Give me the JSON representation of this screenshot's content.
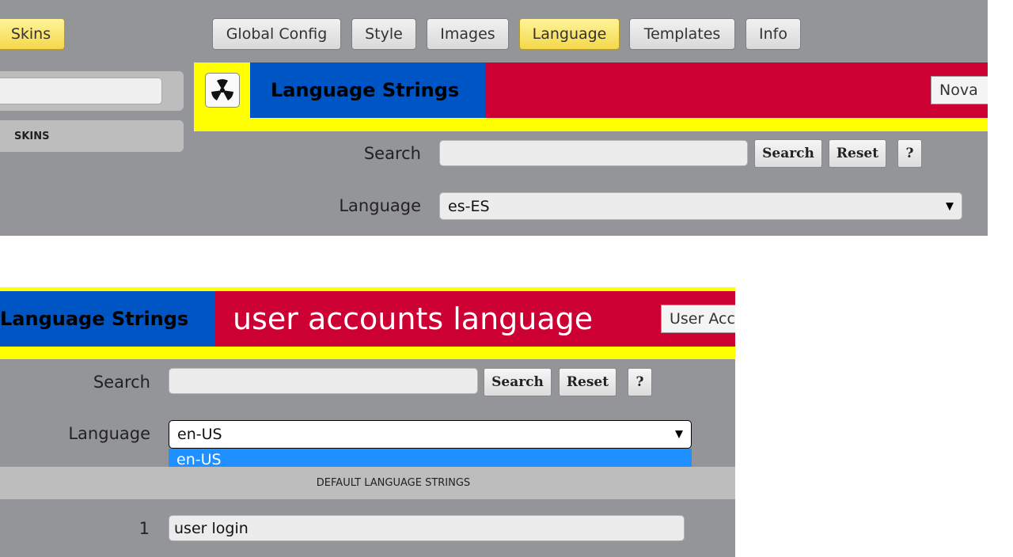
{
  "top": {
    "left_tab": {
      "label": "Skins"
    },
    "tabs": [
      {
        "label": "Global Config"
      },
      {
        "label": "Style"
      },
      {
        "label": "Images"
      },
      {
        "label": "Language",
        "active": true
      },
      {
        "label": "Templates"
      },
      {
        "label": "Info"
      }
    ],
    "sidebar_label": "SKINS",
    "header_title": "Language Strings",
    "skin_button": "Nova",
    "search_label": "Search",
    "search_button": "Search",
    "reset_button": "Reset",
    "help_button": "?",
    "language_label": "Language",
    "language_value": "es-ES"
  },
  "bottom": {
    "header_title": "Language Strings",
    "header_subtitle": "user accounts language",
    "skin_button": "User Acco",
    "search_label": "Search",
    "search_button": "Search",
    "reset_button": "Reset",
    "help_button": "?",
    "language_label": "Language",
    "language_value": "en-US",
    "dropdown_options": [
      "en-US"
    ],
    "section_header": "DEFAULT LANGUAGE STRINGS",
    "rows": [
      {
        "num": "1",
        "value": "user login"
      }
    ]
  },
  "colors": {
    "panel_gray": "#939598",
    "band_yellow": "#ffff00",
    "title_blue": "#0055c4",
    "band_red": "#cc0033",
    "active_tab": "#f4d74a",
    "dropdown_highlight": "#1e90ff"
  },
  "icons": {
    "hazard": "radiation-icon",
    "select_arrow": "caret-down-icon"
  }
}
